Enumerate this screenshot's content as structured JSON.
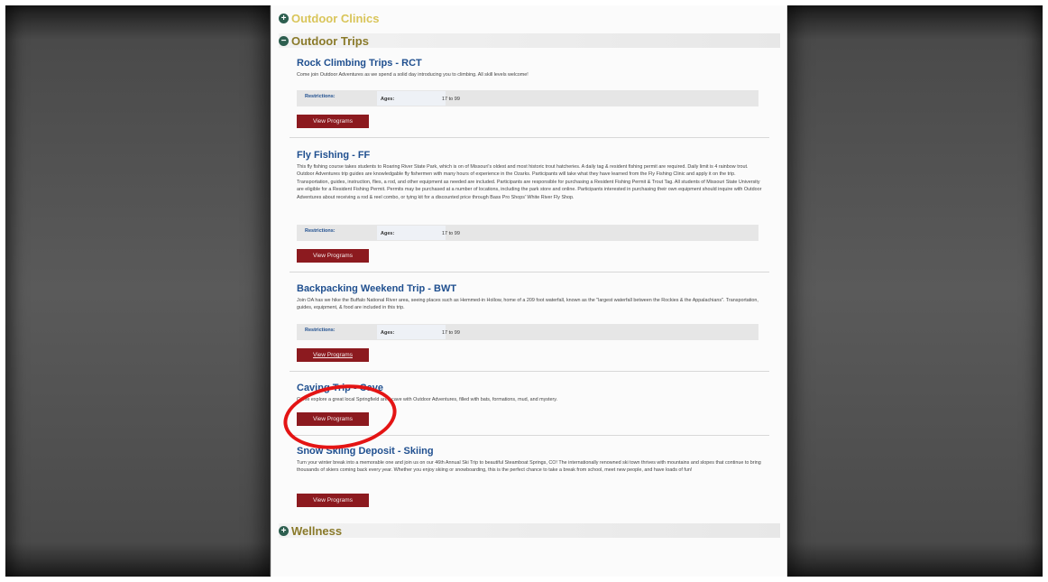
{
  "sections": {
    "clinics": {
      "label": "Outdoor Clinics",
      "toggle": "+"
    },
    "trips": {
      "label": "Outdoor Trips",
      "toggle": "−"
    },
    "wellness": {
      "label": "Wellness",
      "toggle": "+"
    }
  },
  "programs": [
    {
      "title": "Rock Climbing Trips - RCT",
      "description": "Come join Outdoor Adventures as we spend a solid day introducing you to climbing. All skill levels welcome!",
      "restrictions_label": "Restrictions:",
      "ages_label": "Ages:",
      "ages_value": "17 to 99",
      "button_label": "View Programs"
    },
    {
      "title": "Fly Fishing - FF",
      "description": "This fly fishing course takes students to Roaring River State Park, which is on of Missouri's oldest and most historic trout hatcheries. A daily tag & resident fishing permit are required. Daily limit is 4 rainbow trout. Outdoor Adventures trip guides are knowledgable fly fishermen with many hours of experience in the Ozarks. Participants will take what they have learned from the Fly Fishing Clinic and apply it on the trip. Transportation, guides, instruction, flies, a rod, and other equipment as needed are included. Participants are responsible for purchasing a Resident Fishing Permit & Trout Tag. All students of Missouri State University are eligible for a Resident Fishing Permit. Permits may be purchased at a number of locations, including the park store and online. Participants interested in purchasing their own equipment should inquire with Outdoor Adventures about receiving a rod & reel combo, or tying kit for a discounted price through Bass Pro Shops' White River Fly Shop.",
      "restrictions_label": "Restrictions:",
      "ages_label": "Ages:",
      "ages_value": "17 to 99",
      "button_label": "View Programs"
    },
    {
      "title": "Backpacking Weekend Trip - BWT",
      "description": "Join OA has we hike the Buffalo National River area, seeing places such as Hemmed-in Hollow, home of a 209 foot waterfall, known as the \"largest waterfall between the Rockies & the Appalachians\". Transportation, guides, equipment, & food are included in this trip.",
      "restrictions_label": "Restrictions:",
      "ages_label": "Ages:",
      "ages_value": "17 to 99",
      "button_label": "View Programs"
    },
    {
      "title": "Caving Trip - Cave",
      "description": "Come explore a great local Springfield area cave with Outdoor Adventures, filled with bats, formations, mud, and mystery.",
      "button_label": "View Programs"
    },
    {
      "title": "Snow Skiing Deposit - Skiing",
      "description": "Turn your winter break into a memorable one and join us on our 46th Annual Ski Trip to beautiful Steamboat Springs, CO! The internationally renowned ski town thrives with mountains and slopes that continue to bring thousands of skiers coming back every year. Whether you enjoy skiing or snowboarding, this is the perfect chance to take a break from school, meet new people, and have loads of fun!",
      "button_label": "View Programs"
    }
  ],
  "annotation": {
    "shape": "ellipse",
    "color": "#e41414"
  },
  "colors": {
    "button": "#8c1a1f",
    "title_link": "#1f4f8f",
    "section_icon": "#2d5e4f"
  }
}
